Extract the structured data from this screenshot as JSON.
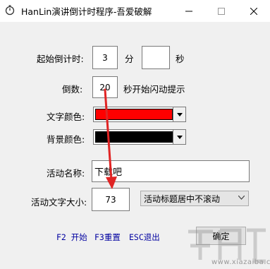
{
  "window": {
    "title": "HanLin演讲倒计时程序-吾爱破解",
    "controls": [
      "minimize-icon",
      "maximize-icon",
      "close-icon"
    ]
  },
  "form": {
    "start_label": "起始倒计时:",
    "minutes_value": "3",
    "minutes_unit": "分",
    "seconds_value": "",
    "seconds_unit": "秒",
    "countdown_label": "倒数:",
    "countdown_value": "20",
    "countdown_suffix": "秒开始闪动提示",
    "text_color_label": "文字颜色:",
    "text_color": "#ff0000",
    "bg_color_label": "背景颜色:",
    "bg_color": "#000000",
    "event_name_label": "活动名称:",
    "event_name_value": "下载吧",
    "event_size_label": "活动文字大小:",
    "event_size_value": "73",
    "scroll_option": "活动标题居中不滚动"
  },
  "footer": {
    "f2": "F2 开始",
    "f3": "F3重置",
    "esc": "ESC退出",
    "ok": "确定"
  },
  "annotation": {
    "arrow_color": "#e02424"
  },
  "watermark": {
    "url": "www.xiazaiba.com"
  }
}
